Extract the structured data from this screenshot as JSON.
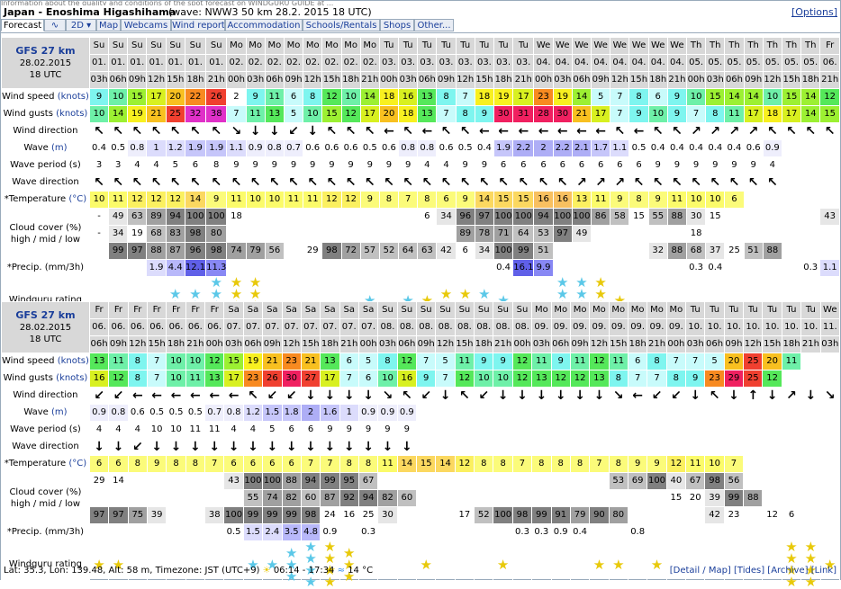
{
  "title": "Japan - Enoshima Higashihama",
  "model_info": "(wave: NWW3 50 km 28.2. 2015 18 UTC)",
  "options_link": "[Options]",
  "top_note": "Information about the quality and conditions of the spot forecast on WINDGURU GUIDE at ...",
  "tabs": [
    "Forecast",
    "∿",
    "2D ▾",
    "Map",
    "Webcams",
    "Wind reports",
    "Accommodation",
    "Schools/Rentals",
    "Shops",
    "Other..."
  ],
  "labels": {
    "wind_speed": "Wind speed",
    "wind_gusts": "Wind gusts",
    "knots": "(knots)",
    "wind_direction": "Wind direction",
    "wave": "Wave",
    "m": "(m)",
    "wave_period": "Wave period (s)",
    "wave_direction": "Wave direction",
    "temperature": "*Temperature",
    "celsius": "(°C)",
    "cloud_line1": "Cloud cover (%)",
    "cloud_line2": "high / mid / low",
    "precip": "*Precip. (mm/3h)",
    "rating": "Windguru rating"
  },
  "blocks": [
    {
      "model": "GFS 27 km",
      "date": "28.02.2015",
      "time": "18 UTC",
      "weekdays": [
        "Su",
        "Su",
        "Su",
        "Su",
        "Su",
        "Su",
        "Su",
        "Mo",
        "Mo",
        "Mo",
        "Mo",
        "Mo",
        "Mo",
        "Mo",
        "Mo",
        "Tu",
        "Tu",
        "Tu",
        "Tu",
        "Tu",
        "Tu",
        "Tu",
        "Tu",
        "We",
        "We",
        "We",
        "We",
        "We",
        "We",
        "We",
        "We",
        "Th",
        "Th",
        "Th",
        "Th",
        "Th",
        "Th",
        "Th",
        "Fr"
      ],
      "dates": [
        "01.",
        "01.",
        "01.",
        "01.",
        "01.",
        "01.",
        "01.",
        "02.",
        "02.",
        "02.",
        "02.",
        "02.",
        "02.",
        "02.",
        "02.",
        "03.",
        "03.",
        "03.",
        "03.",
        "03.",
        "03.",
        "03.",
        "03.",
        "04.",
        "04.",
        "04.",
        "04.",
        "04.",
        "04.",
        "04.",
        "04.",
        "05.",
        "05.",
        "05.",
        "05.",
        "05.",
        "05.",
        "05.",
        "06."
      ],
      "hours": [
        "03h",
        "06h",
        "09h",
        "12h",
        "15h",
        "18h",
        "21h",
        "00h",
        "03h",
        "06h",
        "09h",
        "12h",
        "15h",
        "18h",
        "21h",
        "00h",
        "03h",
        "06h",
        "09h",
        "12h",
        "15h",
        "18h",
        "21h",
        "00h",
        "03h",
        "06h",
        "09h",
        "12h",
        "15h",
        "18h",
        "21h",
        "00h",
        "03h",
        "06h",
        "09h",
        "12h",
        "15h",
        "18h",
        "21h"
      ],
      "wind_speed": [
        "9",
        "10",
        "15",
        "17",
        "20",
        "22",
        "26",
        "2",
        "9",
        "11",
        "6",
        "8",
        "12",
        "10",
        "14",
        "18",
        "16",
        "13",
        "8",
        "7",
        "18",
        "19",
        "17",
        "23",
        "19",
        "14",
        "5",
        "7",
        "8",
        "6",
        "9",
        "10",
        "15",
        "14",
        "14",
        "10",
        "15",
        "14",
        "12"
      ],
      "wind_gusts": [
        "10",
        "14",
        "19",
        "21",
        "25",
        "32",
        "38",
        "7",
        "11",
        "13",
        "5",
        "10",
        "15",
        "12",
        "17",
        "20",
        "18",
        "13",
        "7",
        "8",
        "9",
        "30",
        "31",
        "28",
        "30",
        "21",
        "17",
        "7",
        "9",
        "10",
        "9",
        "7",
        "8",
        "11",
        "17",
        "18",
        "17",
        "14",
        "15"
      ],
      "wind_dir": [
        "↖",
        "↖",
        "↖",
        "↖",
        "↖",
        "↖",
        "↖",
        "↘",
        "↓",
        "↓",
        "↙",
        "↓",
        "↖",
        "↖",
        "↖",
        "←",
        "↖",
        "←",
        "↖",
        "↖",
        "←",
        "←",
        "←",
        "←",
        "←",
        "←",
        "←",
        "↖",
        "←",
        "↖",
        "↖",
        "↗",
        "↗",
        "↗",
        "↗",
        "↖",
        "↖",
        "↖",
        "↖"
      ],
      "wave": [
        "0.4",
        "0.5",
        "0.8",
        "1",
        "1.2",
        "1.9",
        "1.9",
        "1.1",
        "0.9",
        "0.8",
        "0.7",
        "0.6",
        "0.6",
        "0.6",
        "0.5",
        "0.6",
        "0.8",
        "0.8",
        "0.6",
        "0.5",
        "0.4",
        "1.9",
        "2.2",
        "2",
        "2.2",
        "2.1",
        "1.7",
        "1.1",
        "0.5",
        "0.4",
        "0.4",
        "0.4",
        "0.4",
        "0.4",
        "0.6",
        "0.9",
        "",
        "",
        ""
      ],
      "wave_period": [
        "3",
        "3",
        "4",
        "4",
        "5",
        "6",
        "8",
        "9",
        "9",
        "9",
        "9",
        "9",
        "9",
        "9",
        "9",
        "9",
        "9",
        "4",
        "4",
        "9",
        "9",
        "6",
        "6",
        "6",
        "6",
        "6",
        "6",
        "6",
        "6",
        "9",
        "9",
        "9",
        "9",
        "9",
        "9",
        "4",
        "",
        "",
        ""
      ],
      "wave_dir": [
        "↖",
        "↖",
        "↖",
        "↖",
        "↖",
        "↖",
        "↖",
        "↖",
        "↖",
        "↖",
        "↖",
        "↖",
        "↖",
        "↖",
        "↖",
        "↖",
        "↖",
        "↖",
        "↖",
        "↖",
        "↖",
        "↖",
        "↖",
        "↖",
        "↖",
        "↗",
        "↗",
        "↗",
        "↖",
        "↖",
        "↖",
        "↖",
        "↖",
        "↖",
        "↖",
        "↖",
        "",
        "",
        ""
      ],
      "temperature": [
        "10",
        "11",
        "12",
        "12",
        "12",
        "14",
        "9",
        "11",
        "10",
        "10",
        "11",
        "11",
        "12",
        "12",
        "9",
        "8",
        "7",
        "8",
        "6",
        "9",
        "14",
        "15",
        "15",
        "16",
        "16",
        "13",
        "11",
        "9",
        "8",
        "9",
        "11",
        "10",
        "10",
        "6",
        "",
        "",
        "",
        "",
        ""
      ],
      "cloud_high": [
        "-",
        "49",
        "63",
        "89",
        "94",
        "100",
        "100",
        "18",
        "",
        "",
        "",
        "",
        "",
        "",
        "",
        "",
        "",
        "6",
        "34",
        "96",
        "97",
        "100",
        "100",
        "94",
        "100",
        "100",
        "86",
        "58",
        "15",
        "55",
        "88",
        "30",
        "15",
        "",
        "",
        "",
        "",
        "",
        "43"
      ],
      "cloud_mid": [
        "-",
        "34",
        "19",
        "68",
        "83",
        "98",
        "80",
        "",
        "",
        "",
        "",
        "",
        "",
        "",
        "",
        "",
        "",
        "",
        "",
        "89",
        "78",
        "71",
        "64",
        "53",
        "97",
        "49",
        "",
        "",
        "",
        "",
        "",
        "18",
        "",
        "",
        "",
        "",
        "",
        "",
        ""
      ],
      "cloud_low": [
        "",
        "99",
        "97",
        "88",
        "87",
        "96",
        "98",
        "74",
        "79",
        "56",
        "",
        "29",
        "98",
        "72",
        "57",
        "52",
        "64",
        "63",
        "42",
        "6",
        "34",
        "100",
        "99",
        "51",
        "",
        "",
        "",
        "",
        "",
        "32",
        "88",
        "68",
        "37",
        "25",
        "51",
        "88",
        "",
        "",
        ""
      ],
      "precip": [
        "",
        "",
        "",
        "1.9",
        "4.4",
        "12.1",
        "11.3",
        "",
        "",
        "",
        "",
        "",
        "",
        "",
        "",
        "",
        "",
        "",
        "",
        "",
        "",
        "0.4",
        "16.1",
        "9.9",
        "",
        "",
        "",
        "",
        "",
        "",
        "",
        "0.3",
        "0.4",
        "",
        "",
        "",
        "",
        "0.3",
        "1.1"
      ],
      "rating": [
        "",
        "",
        "",
        "",
        "2",
        "2",
        "4",
        "4",
        "4",
        "",
        "",
        "",
        "",
        "",
        "1",
        "",
        "1",
        "1",
        "2",
        "2",
        "2",
        "1",
        "",
        "",
        "4",
        "4",
        "4",
        "1",
        "",
        "",
        "",
        "",
        "",
        "",
        "",
        "",
        "",
        "",
        ""
      ]
    },
    {
      "model": "GFS 27 km",
      "date": "28.02.2015",
      "time": "18 UTC",
      "weekdays": [
        "Fr",
        "Fr",
        "Fr",
        "Fr",
        "Fr",
        "Fr",
        "Fr",
        "Sa",
        "Sa",
        "Sa",
        "Sa",
        "Sa",
        "Sa",
        "Sa",
        "Sa",
        "Su",
        "Su",
        "Su",
        "Su",
        "Su",
        "Su",
        "Su",
        "Su",
        "Mo",
        "Mo",
        "Mo",
        "Mo",
        "Mo",
        "Mo",
        "Mo",
        "Mo",
        "Tu",
        "Tu",
        "Tu",
        "Tu",
        "Tu",
        "Tu",
        "Tu",
        "We"
      ],
      "dates": [
        "06.",
        "06.",
        "06.",
        "06.",
        "06.",
        "06.",
        "06.",
        "07.",
        "07.",
        "07.",
        "07.",
        "07.",
        "07.",
        "07.",
        "07.",
        "08.",
        "08.",
        "08.",
        "08.",
        "08.",
        "08.",
        "08.",
        "08.",
        "09.",
        "09.",
        "09.",
        "09.",
        "09.",
        "09.",
        "09.",
        "09.",
        "10.",
        "10.",
        "10.",
        "10.",
        "10.",
        "10.",
        "10.",
        "11."
      ],
      "hours": [
        "06h",
        "09h",
        "12h",
        "15h",
        "18h",
        "21h",
        "00h",
        "03h",
        "06h",
        "09h",
        "12h",
        "15h",
        "18h",
        "21h",
        "00h",
        "03h",
        "06h",
        "09h",
        "12h",
        "15h",
        "18h",
        "21h",
        "00h",
        "03h",
        "06h",
        "09h",
        "12h",
        "15h",
        "18h",
        "21h",
        "00h",
        "03h",
        "06h",
        "09h",
        "12h",
        "15h",
        "18h",
        "21h",
        "03h"
      ],
      "wind_speed": [
        "13",
        "11",
        "8",
        "7",
        "10",
        "10",
        "12",
        "15",
        "19",
        "21",
        "23",
        "21",
        "13",
        "6",
        "5",
        "8",
        "12",
        "7",
        "5",
        "11",
        "9",
        "9",
        "12",
        "11",
        "9",
        "11",
        "12",
        "11",
        "6",
        "8",
        "7",
        "7",
        "5",
        "20",
        "25",
        "20",
        "11",
        "",
        ""
      ],
      "wind_gusts": [
        "16",
        "12",
        "8",
        "7",
        "10",
        "11",
        "13",
        "17",
        "23",
        "26",
        "30",
        "27",
        "17",
        "7",
        "6",
        "10",
        "16",
        "9",
        "7",
        "12",
        "10",
        "10",
        "12",
        "13",
        "12",
        "12",
        "13",
        "8",
        "7",
        "7",
        "8",
        "9",
        "23",
        "29",
        "25",
        "12",
        "",
        "",
        ""
      ],
      "wind_dir": [
        "↙",
        "↙",
        "←",
        "←",
        "←",
        "←",
        "←",
        "←",
        "↖",
        "↙",
        "↙",
        "↓",
        "↓",
        "↓",
        "↓",
        "↘",
        "↖",
        "↙",
        "↓",
        "↖",
        "↙",
        "↓",
        "↓",
        "↓",
        "↓",
        "↓",
        "↓",
        "↘",
        "←",
        "↙",
        "↙",
        "↓",
        "↖",
        "↓",
        "↑",
        "↓",
        "↗",
        "↓",
        "↘"
      ],
      "wave": [
        "0.9",
        "0.8",
        "0.6",
        "0.5",
        "0.5",
        "0.5",
        "0.7",
        "0.8",
        "1.2",
        "1.5",
        "1.8",
        "2",
        "1.6",
        "1",
        "0.9",
        "0.9",
        "0.9",
        "",
        "",
        "",
        "",
        "",
        "",
        "",
        "",
        "",
        "",
        "",
        "",
        "",
        "",
        "",
        "",
        "",
        "",
        "",
        "",
        "",
        ""
      ],
      "wave_period": [
        "4",
        "4",
        "4",
        "10",
        "10",
        "11",
        "11",
        "4",
        "4",
        "5",
        "6",
        "6",
        "9",
        "9",
        "9",
        "9",
        "9",
        "",
        "",
        "",
        "",
        "",
        "",
        "",
        "",
        "",
        "",
        "",
        "",
        "",
        "",
        "",
        "",
        "",
        "",
        "",
        "",
        "",
        ""
      ],
      "wave_dir": [
        "↓",
        "↓",
        "↙",
        "↓",
        "↓",
        "↓",
        "↓",
        "↓",
        "↓",
        "↓",
        "↓",
        "↓",
        "↓",
        "↓",
        "↓",
        "↓",
        "↓",
        "",
        "",
        "",
        "",
        "",
        "",
        "",
        "",
        "",
        "",
        "",
        "",
        "",
        "",
        "",
        "",
        "",
        "",
        "",
        "",
        "",
        ""
      ],
      "temperature": [
        "6",
        "6",
        "8",
        "9",
        "8",
        "8",
        "7",
        "6",
        "6",
        "6",
        "6",
        "7",
        "7",
        "8",
        "8",
        "11",
        "14",
        "15",
        "14",
        "12",
        "8",
        "8",
        "7",
        "8",
        "8",
        "8",
        "7",
        "8",
        "9",
        "9",
        "12",
        "11",
        "10",
        "7",
        "",
        "",
        "",
        "",
        ""
      ],
      "cloud_high": [
        "29",
        "14",
        "",
        "",
        "",
        "",
        "",
        "43",
        "100",
        "100",
        "88",
        "94",
        "99",
        "95",
        "67",
        "",
        "",
        "",
        "",
        "",
        "",
        "",
        "",
        "",
        "",
        "",
        "",
        "53",
        "69",
        "100",
        "40",
        "67",
        "98",
        "56",
        "",
        "",
        "",
        "",
        ""
      ],
      "cloud_mid": [
        "",
        "",
        "",
        "",
        "",
        "",
        "",
        "",
        "55",
        "74",
        "82",
        "60",
        "87",
        "92",
        "94",
        "82",
        "60",
        "",
        "",
        "",
        "",
        "",
        "",
        "",
        "",
        "",
        "",
        "",
        "",
        "",
        "15",
        "20",
        "39",
        "99",
        "88",
        "",
        "",
        "",
        ""
      ],
      "cloud_low": [
        "97",
        "97",
        "75",
        "39",
        "",
        "",
        "38",
        "100",
        "99",
        "99",
        "99",
        "98",
        "24",
        "16",
        "25",
        "30",
        "",
        "",
        "",
        "17",
        "52",
        "100",
        "98",
        "99",
        "91",
        "79",
        "90",
        "80",
        "",
        "",
        "",
        "",
        "42",
        "23",
        "",
        "12",
        "6",
        "",
        ""
      ],
      "precip": [
        "",
        "",
        "",
        "",
        "",
        "",
        "",
        "0.5",
        "1.5",
        "2.4",
        "3.5",
        "4.8",
        "0.9",
        "",
        "0.3",
        "",
        "",
        "",
        "",
        "",
        "",
        "",
        "0.3",
        "0.3",
        "0.9",
        "0.4",
        "",
        "",
        "0.8",
        "",
        "",
        "",
        "",
        "",
        "",
        "",
        "",
        "",
        ""
      ],
      "rating": [
        "1",
        "1",
        "",
        "",
        "",
        "",
        "",
        "",
        "1",
        "1",
        "3",
        "4",
        "4",
        "3",
        "",
        "",
        "",
        "1",
        "",
        "",
        "",
        "1",
        "",
        "",
        "",
        "",
        "1",
        "1",
        "",
        "1",
        "",
        "",
        "",
        "",
        "",
        "",
        "4",
        "4",
        "1"
      ]
    }
  ],
  "rating_colors": {
    "blue": "#5bc8e8",
    "yellow": "#e8c90a"
  },
  "footer": {
    "coords": "Lat: 35.3, Lon: 139.48, Alt: 58 m, Timezone: JST (UTC+9)",
    "sun": "06:14 - 17:34",
    "water_temp": "14 °C",
    "links": [
      "[Detail / Map]",
      "[Tides]",
      "[Archive]",
      "[Link]"
    ]
  }
}
